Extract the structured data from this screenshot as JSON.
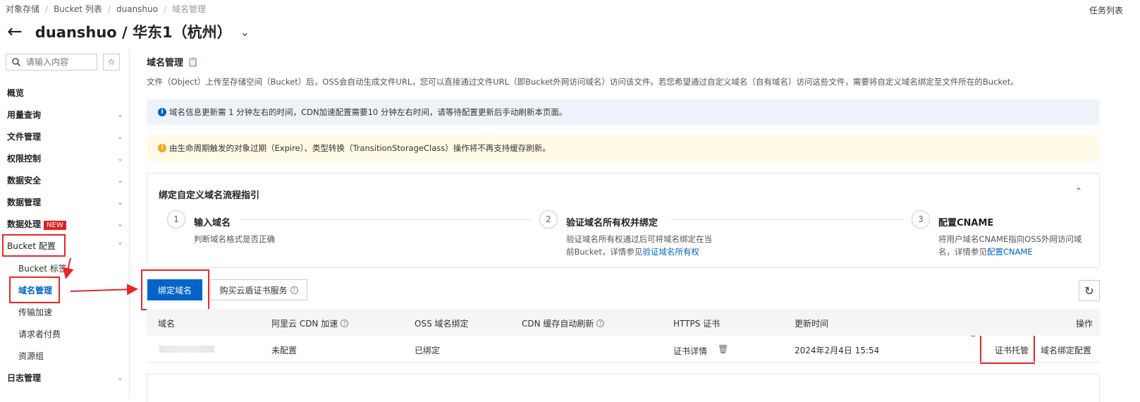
{
  "breadcrumb": [
    "对象存储",
    "Bucket 列表",
    "duanshuo",
    "域名管理"
  ],
  "task_list": "任务列表",
  "page": {
    "title": "duanshuo / 华东1（杭州）"
  },
  "sidebar": {
    "search_placeholder": "请输入内容",
    "items": [
      {
        "label": "概览"
      },
      {
        "label": "用量查询"
      },
      {
        "label": "文件管理"
      },
      {
        "label": "权限控制"
      },
      {
        "label": "数据安全"
      },
      {
        "label": "数据管理"
      },
      {
        "label": "数据处理",
        "badge": "NEW"
      },
      {
        "label": "Bucket 配置"
      },
      {
        "label": "日志管理"
      }
    ],
    "sub_items": [
      "Bucket 标签",
      "域名管理",
      "传输加速",
      "请求者付费",
      "资源组"
    ]
  },
  "main": {
    "title": "域名管理",
    "description": "文件（Object）上传至存储空间（Bucket）后，OSS会自动生成文件URL，您可以直接通过文件URL（即Bucket外网访问域名）访问该文件。若您希望通过自定义域名（自有域名）访问这些文件，需要将自定义域名绑定至文件所在的Bucket。",
    "info_note": "域名信息更新需 1 分钟左右的时间，CDN加速配置需要10 分钟左右时间，请等待配置更新后手动刷新本页面。",
    "warn_note": "由生命周期触发的对象过期（Expire）、类型转换（TransitionStorageClass）操作将不再支持缓存刷新。"
  },
  "guide": {
    "title": "绑定自定义域名流程指引",
    "steps": [
      {
        "num": "1",
        "title": "输入域名",
        "desc1": "判断域名格式是否正确",
        "desc2": "",
        "link": ""
      },
      {
        "num": "2",
        "title": "验证域名所有权并绑定",
        "desc1": "验证域名所有权通过后可将域名绑定在当",
        "desc2": "前Bucket，详情参见",
        "link": "验证域名所有权"
      },
      {
        "num": "3",
        "title": "配置CNAME",
        "desc1": "将用户域名CNAME指向OSS外网访问域",
        "desc2": "名，详情参见",
        "link": "配置CNAME"
      }
    ]
  },
  "toolbar": {
    "bind_domain": "绑定域名",
    "buy_cert": "购买云盾证书服务"
  },
  "table": {
    "headers": [
      "域名",
      "阿里云 CDN 加速",
      "OSS 域名绑定",
      "CDN 缓存自动刷新",
      "HTTPS 证书",
      "更新时间",
      "操作"
    ],
    "rows": [
      {
        "cdn": "未配置",
        "oss_bind": "已绑定",
        "cert": "证书详情",
        "updated": "2024年2月4日 15:54",
        "op1": "证书托管",
        "op2": "域名绑定配置"
      }
    ]
  }
}
